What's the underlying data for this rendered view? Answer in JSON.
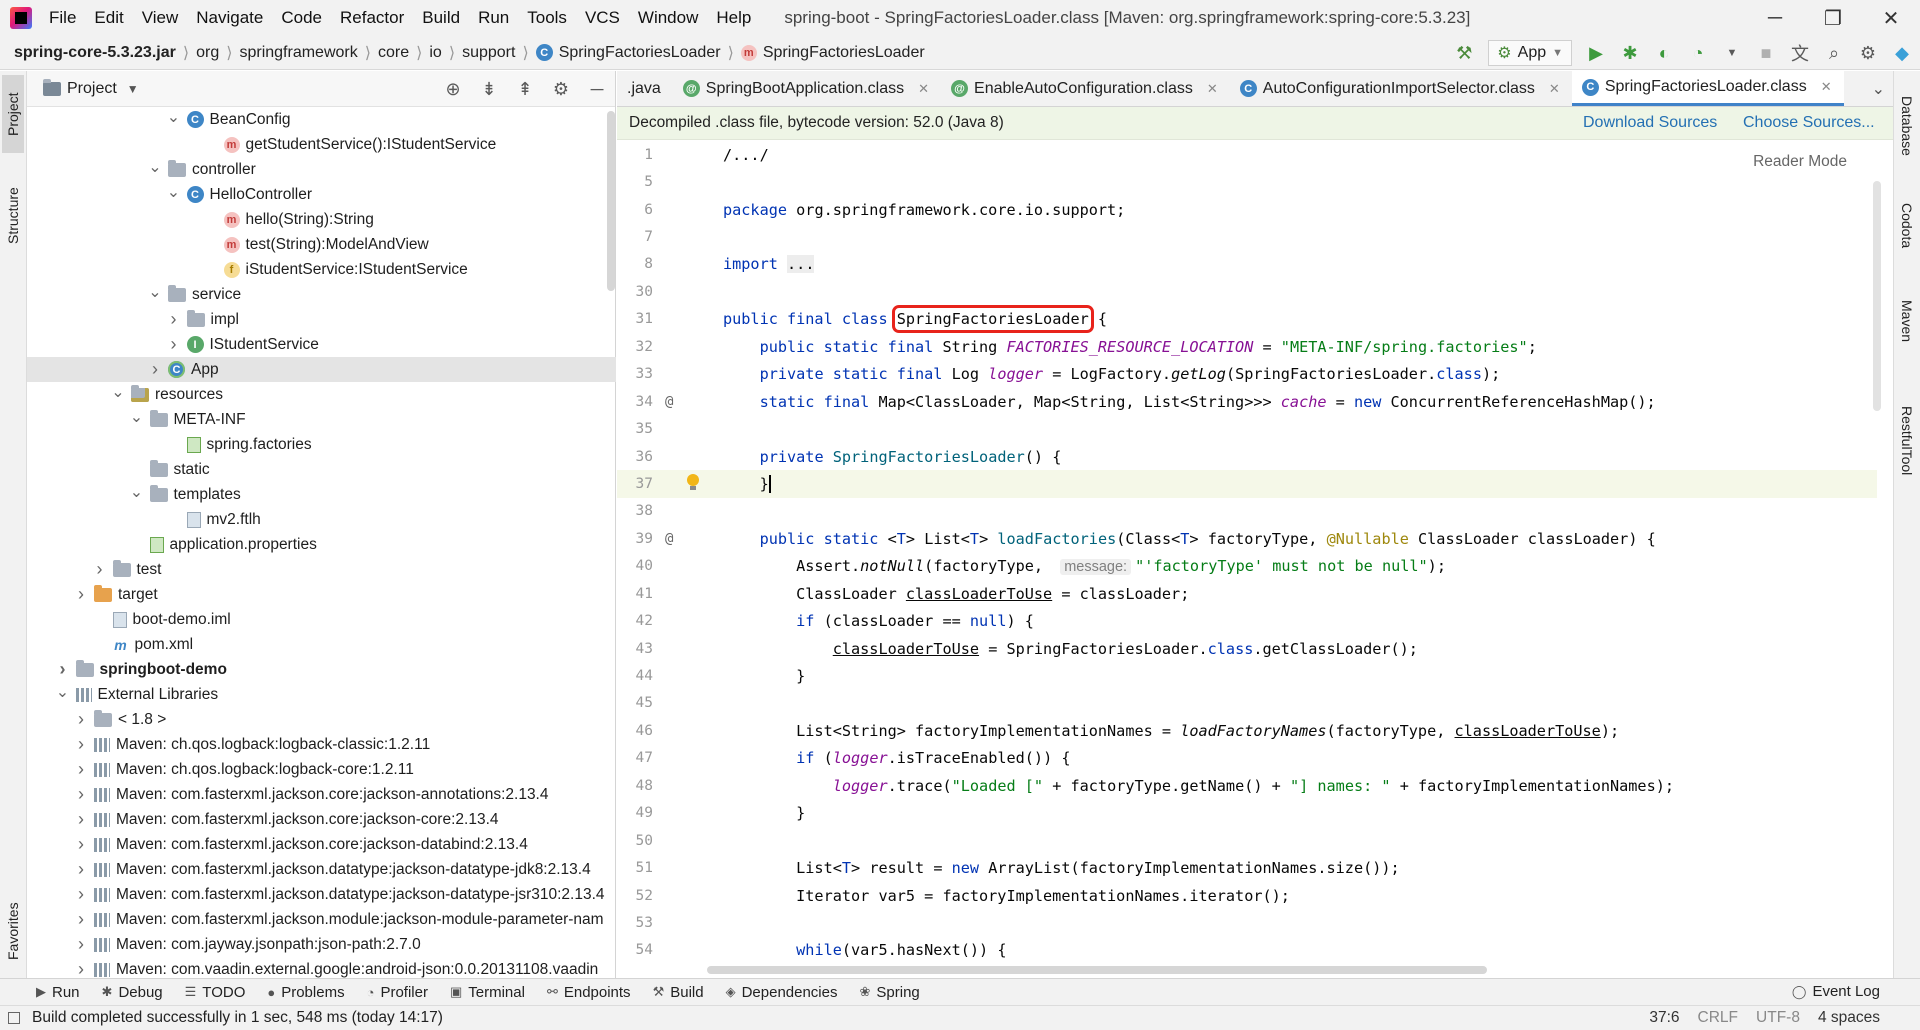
{
  "window": {
    "title": "spring-boot - SpringFactoriesLoader.class [Maven: org.springframework:spring-core:5.3.23]",
    "menu": [
      "File",
      "Edit",
      "View",
      "Navigate",
      "Code",
      "Refactor",
      "Build",
      "Run",
      "Tools",
      "VCS",
      "Window",
      "Help"
    ],
    "controls": {
      "minimize": "─",
      "restore": "❐",
      "close": "✕"
    }
  },
  "navbar": {
    "breadcrumbs": [
      "spring-core-5.3.23.jar",
      "org",
      "springframework",
      "core",
      "io",
      "support",
      "SpringFactoriesLoader",
      "SpringFactoriesLoader"
    ],
    "run_config": "App"
  },
  "left_strip": {
    "project_tab": "Project",
    "structure_tab": "Structure",
    "favorites_tab": "Favorites"
  },
  "project_panel": {
    "title": "Project",
    "tree": [
      {
        "indent": 7,
        "arrow": "v",
        "icon": "class",
        "text": "BeanConfig"
      },
      {
        "indent": 9,
        "arrow": "",
        "icon": "method",
        "text": "getStudentService():IStudentService"
      },
      {
        "indent": 6,
        "arrow": "v",
        "icon": "folder",
        "text": "controller"
      },
      {
        "indent": 7,
        "arrow": "v",
        "icon": "class",
        "text": "HelloController"
      },
      {
        "indent": 9,
        "arrow": "",
        "icon": "method",
        "text": "hello(String):String"
      },
      {
        "indent": 9,
        "arrow": "",
        "icon": "method",
        "text": "test(String):ModelAndView"
      },
      {
        "indent": 9,
        "arrow": "",
        "icon": "field",
        "text": "iStudentService:IStudentService"
      },
      {
        "indent": 6,
        "arrow": "v",
        "icon": "folder",
        "text": "service"
      },
      {
        "indent": 7,
        "arrow": ">",
        "icon": "folder",
        "text": "impl"
      },
      {
        "indent": 7,
        "arrow": ">",
        "icon": "interface",
        "text": "IStudentService"
      },
      {
        "indent": 6,
        "arrow": ">",
        "icon": "app",
        "text": "App",
        "selected": true
      },
      {
        "indent": 4,
        "arrow": "v",
        "icon": "resfolder",
        "text": "resources"
      },
      {
        "indent": 5,
        "arrow": "v",
        "icon": "folder",
        "text": "META-INF"
      },
      {
        "indent": 7,
        "arrow": "",
        "icon": "greenfile",
        "text": "spring.factories"
      },
      {
        "indent": 5,
        "arrow": "",
        "icon": "folder",
        "text": "static"
      },
      {
        "indent": 5,
        "arrow": "v",
        "icon": "folder",
        "text": "templates"
      },
      {
        "indent": 7,
        "arrow": "",
        "icon": "file",
        "text": "mv2.ftlh"
      },
      {
        "indent": 5,
        "arrow": "",
        "icon": "greenfile",
        "text": "application.properties"
      },
      {
        "indent": 3,
        "arrow": ">",
        "icon": "folder",
        "text": "test"
      },
      {
        "indent": 2,
        "arrow": ">",
        "icon": "orangefolder",
        "text": "target"
      },
      {
        "indent": 3,
        "arrow": "",
        "icon": "file",
        "text": "boot-demo.iml"
      },
      {
        "indent": 3,
        "arrow": "",
        "icon": "maven",
        "text": "pom.xml"
      },
      {
        "indent": 1,
        "arrow": ">",
        "icon": "folder",
        "text": "springboot-demo",
        "bold": true
      },
      {
        "indent": 1,
        "arrow": "v",
        "icon": "lib",
        "text": "External Libraries"
      },
      {
        "indent": 2,
        "arrow": ">",
        "icon": "folder",
        "text": "< 1.8 >"
      },
      {
        "indent": 2,
        "arrow": ">",
        "icon": "lib",
        "text": "Maven: ch.qos.logback:logback-classic:1.2.11"
      },
      {
        "indent": 2,
        "arrow": ">",
        "icon": "lib",
        "text": "Maven: ch.qos.logback:logback-core:1.2.11"
      },
      {
        "indent": 2,
        "arrow": ">",
        "icon": "lib",
        "text": "Maven: com.fasterxml.jackson.core:jackson-annotations:2.13.4"
      },
      {
        "indent": 2,
        "arrow": ">",
        "icon": "lib",
        "text": "Maven: com.fasterxml.jackson.core:jackson-core:2.13.4"
      },
      {
        "indent": 2,
        "arrow": ">",
        "icon": "lib",
        "text": "Maven: com.fasterxml.jackson.core:jackson-databind:2.13.4"
      },
      {
        "indent": 2,
        "arrow": ">",
        "icon": "lib",
        "text": "Maven: com.fasterxml.jackson.datatype:jackson-datatype-jdk8:2.13.4"
      },
      {
        "indent": 2,
        "arrow": ">",
        "icon": "lib",
        "text": "Maven: com.fasterxml.jackson.datatype:jackson-datatype-jsr310:2.13.4"
      },
      {
        "indent": 2,
        "arrow": ">",
        "icon": "lib",
        "text": "Maven: com.fasterxml.jackson.module:jackson-module-parameter-nam"
      },
      {
        "indent": 2,
        "arrow": ">",
        "icon": "lib",
        "text": "Maven: com.jayway.jsonpath:json-path:2.7.0"
      },
      {
        "indent": 2,
        "arrow": ">",
        "icon": "lib",
        "text": "Maven: com.vaadin.external.google:android-json:0.0.20131108.vaadin"
      }
    ]
  },
  "editor": {
    "tabs": [
      {
        "label": ".java",
        "icon": "",
        "active": false
      },
      {
        "label": "SpringBootApplication.class",
        "icon": "annotation",
        "active": false
      },
      {
        "label": "EnableAutoConfiguration.class",
        "icon": "annotation",
        "active": false
      },
      {
        "label": "AutoConfigurationImportSelector.class",
        "icon": "class",
        "active": false
      },
      {
        "label": "SpringFactoriesLoader.class",
        "icon": "class",
        "active": true
      }
    ],
    "banner": {
      "text": "Decompiled .class file, bytecode version: 52.0 (Java 8)",
      "download_sources": "Download Sources",
      "choose_sources": "Choose Sources..."
    },
    "reader_mode": "Reader Mode",
    "highlighted_token": "SpringFactoriesLoader",
    "lines": [
      {
        "n": "1",
        "html": "/.../"
      },
      {
        "n": "5",
        "html": ""
      },
      {
        "n": "6",
        "html": "<span class='kw'>package</span> org.springframework.core.io.support;"
      },
      {
        "n": "7",
        "html": ""
      },
      {
        "n": "8",
        "html": "<span class='kw'>import</span> <span style='background:#ededed'>...</span>"
      },
      {
        "n": "30",
        "html": ""
      },
      {
        "n": "31",
        "html": "<span class='kw'>public final class</span> <span class='hl-box'>SpringFactoriesLoader</span> {"
      },
      {
        "n": "32",
        "html": "    <span class='kw'>public static final</span> String <span class='sfld'>FACTORIES_RESOURCE_LOCATION</span> = <span class='str'>\"META-INF/spring.factories\"</span>;"
      },
      {
        "n": "33",
        "html": "    <span class='kw'>private static final</span> Log <span class='sfld'>logger</span> = LogFactory.<span class='ital'>getLog</span>(SpringFactoriesLoader.<span class='kw'>class</span>);"
      },
      {
        "n": "34",
        "html": "    <span class='kw'>static final</span> Map&lt;ClassLoader, Map&lt;String, List&lt;String&gt;&gt;&gt; <span class='sfld'>cache</span> = <span class='kw'>new</span> ConcurrentReferenceHashMap();",
        "at": true
      },
      {
        "n": "35",
        "html": ""
      },
      {
        "n": "36",
        "html": "    <span class='kw'>private</span> <span class='fn'>SpringFactoriesLoader</span>() {"
      },
      {
        "n": "37",
        "html": "    }<span class='caret-bar'></span>",
        "current": true,
        "bulb": true
      },
      {
        "n": "38",
        "html": ""
      },
      {
        "n": "39",
        "html": "    <span class='kw'>public static</span> &lt;<span class='kw'>T</span>&gt; List&lt;<span class='kw'>T</span>&gt; <span class='fn'>loadFactories</span>(Class&lt;<span class='kw'>T</span>&gt; factoryType, <span class='ann'>@Nullable</span> ClassLoader classLoader) {",
        "at": true
      },
      {
        "n": "40",
        "html": "        Assert.<span class='ital'>notNull</span>(factoryType, <span class='hint'>message:</span><span class='str'>\"'factoryType' must not be null\"</span>);"
      },
      {
        "n": "41",
        "html": "        ClassLoader <span class='underline'>classLoaderToUse</span> = classLoader;"
      },
      {
        "n": "42",
        "html": "        <span class='kw'>if</span> (classLoader == <span class='kw'>null</span>) {"
      },
      {
        "n": "43",
        "html": "            <span class='underline'>classLoaderToUse</span> = SpringFactoriesLoader.<span class='kw'>class</span>.getClassLoader();"
      },
      {
        "n": "44",
        "html": "        }"
      },
      {
        "n": "45",
        "html": ""
      },
      {
        "n": "46",
        "html": "        List&lt;String&gt; factoryImplementationNames = <span class='ital'>loadFactoryNames</span>(factoryType, <span class='underline'>classLoaderToUse</span>);"
      },
      {
        "n": "47",
        "html": "        <span class='kw'>if</span> (<span class='sfld'>logger</span>.isTraceEnabled()) {"
      },
      {
        "n": "48",
        "html": "            <span class='sfld'>logger</span>.trace(<span class='str'>\"Loaded [\"</span> + factoryType.getName() + <span class='str'>\"] names: \"</span> + factoryImplementationNames);"
      },
      {
        "n": "49",
        "html": "        }"
      },
      {
        "n": "50",
        "html": ""
      },
      {
        "n": "51",
        "html": "        List&lt;<span class='kw'>T</span>&gt; result = <span class='kw'>new</span> ArrayList(factoryImplementationNames.size());"
      },
      {
        "n": "52",
        "html": "        Iterator var5 = factoryImplementationNames.iterator();"
      },
      {
        "n": "53",
        "html": ""
      },
      {
        "n": "54",
        "html": "        <span class='kw'>while</span>(var5.hasNext()) {"
      }
    ]
  },
  "right_strip": {
    "tabs": [
      "Database",
      "Codota",
      "Maven",
      "RestfulTool"
    ]
  },
  "tool_windows": {
    "buttons": [
      {
        "icon": "▶",
        "label": "Run"
      },
      {
        "icon": "✱",
        "label": "Debug"
      },
      {
        "icon": "☰",
        "label": "TODO"
      },
      {
        "icon": "●",
        "label": "Problems"
      },
      {
        "icon": "◔",
        "label": "Profiler"
      },
      {
        "icon": "▣",
        "label": "Terminal"
      },
      {
        "icon": "⚯",
        "label": "Endpoints"
      },
      {
        "icon": "⚒",
        "label": "Build"
      },
      {
        "icon": "◈",
        "label": "Dependencies"
      },
      {
        "icon": "❀",
        "label": "Spring"
      }
    ],
    "event_log": "Event Log"
  },
  "statusbar": {
    "message": "Build completed successfully in 1 sec, 548 ms (today 14:17)",
    "position": "37:6",
    "line_separator": "CRLF",
    "encoding": "UTF-8",
    "indent": "4 spaces"
  },
  "colors": {
    "accent": "#4083c9",
    "highlight_box": "#e8231b",
    "keyword": "#0033b3",
    "string": "#067d17",
    "static_field": "#871094"
  }
}
